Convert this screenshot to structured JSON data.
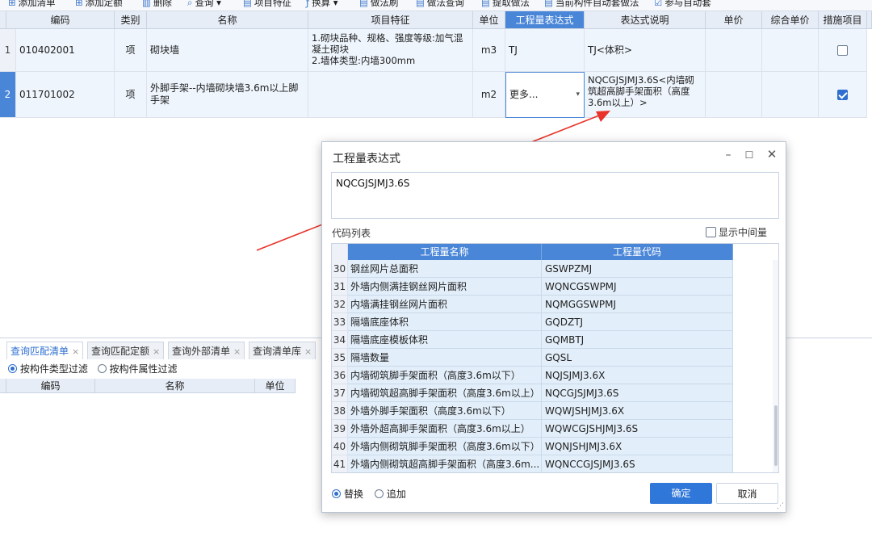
{
  "toolbar": {
    "items": [
      {
        "icon": "add-list-icon",
        "label": "添加清单"
      },
      {
        "icon": "add-quota-icon",
        "label": "添加定额"
      },
      {
        "icon": "delete-icon",
        "label": "删除"
      },
      {
        "icon": "query-icon",
        "label": "查询"
      },
      {
        "icon": "feature-icon",
        "label": "项目特征"
      },
      {
        "icon": "fx-icon",
        "label": "换算"
      },
      {
        "icon": "brush-icon",
        "label": "做法刷"
      },
      {
        "icon": "query-method-icon",
        "label": "做法查询"
      },
      {
        "icon": "extract-icon",
        "label": "提取做法"
      },
      {
        "icon": "auto-icon",
        "label": "当前构件自动套做法"
      },
      {
        "icon": "checkbox-icon",
        "label": "参与自动套"
      }
    ]
  },
  "grid": {
    "headers": [
      "编码",
      "类别",
      "名称",
      "项目特征",
      "单位",
      "工程量表达式",
      "表达式说明",
      "单价",
      "综合单价",
      "措施项目"
    ],
    "rows": [
      {
        "num": "1",
        "code": "010402001",
        "type": "项",
        "name": "砌块墙",
        "feature": "1.砌块品种、规格、强度等级:加气混凝土砌块\n2.墙体类型:内墙300mm",
        "unit": "m3",
        "expr": "TJ",
        "desc": "TJ<体积>",
        "price": "",
        "total_price": "",
        "measure": false
      },
      {
        "num": "2",
        "code": "011701002",
        "type": "项",
        "name": "外脚手架--内墙砌块墙3.6m以上脚手架",
        "feature": "",
        "unit": "m2",
        "expr": "更多...",
        "desc": "NQCGJSJMJ3.6S<内墙砌筑超高脚手架面积（高度3.6m以上）>",
        "price": "",
        "total_price": "",
        "measure": true
      }
    ]
  },
  "bottom": {
    "tabs": [
      "查询匹配清单",
      "查询匹配定额",
      "查询外部清单",
      "查询清单库"
    ],
    "filters": [
      "按构件类型过滤",
      "按构件属性过滤"
    ],
    "headers": [
      "编码",
      "名称",
      "单位"
    ]
  },
  "dialog": {
    "title": "工程量表达式",
    "expression": "NQCGJSJMJ3.6S",
    "codes_label": "代码列表",
    "show_intermediate": "显示中间量",
    "headers": [
      "工程量名称",
      "工程量代码"
    ],
    "rows": [
      {
        "n": "30",
        "name": "钢丝网片总面积",
        "code": "GSWPZMJ"
      },
      {
        "n": "31",
        "name": "外墙内侧满挂钢丝网片面积",
        "code": "WQNCGSWPMJ"
      },
      {
        "n": "32",
        "name": "内墙满挂钢丝网片面积",
        "code": "NQMGGSWPMJ"
      },
      {
        "n": "33",
        "name": "隔墙底座体积",
        "code": "GQDZTJ"
      },
      {
        "n": "34",
        "name": "隔墙底座模板体积",
        "code": "GQMBTJ"
      },
      {
        "n": "35",
        "name": "隔墙数量",
        "code": "GQSL"
      },
      {
        "n": "36",
        "name": "内墙砌筑脚手架面积（高度3.6m以下）",
        "code": "NQJSJMJ3.6X"
      },
      {
        "n": "37",
        "name": "内墙砌筑超高脚手架面积（高度3.6m以上）",
        "code": "NQCGJSJMJ3.6S"
      },
      {
        "n": "38",
        "name": "外墙外脚手架面积（高度3.6m以下）",
        "code": "WQWJSHJMJ3.6X"
      },
      {
        "n": "39",
        "name": "外墙外超高脚手架面积（高度3.6m以上）",
        "code": "WQWCGJSHJMJ3.6S"
      },
      {
        "n": "40",
        "name": "外墙内侧砌筑脚手架面积（高度3.6m以下）",
        "code": "WQNJSHJMJ3.6X"
      },
      {
        "n": "41",
        "name": "外墙内侧砌筑超高脚手架面积（高度3.6m...",
        "code": "WQNCCGJSJMJ3.6S"
      }
    ],
    "mode_replace": "替换",
    "mode_append": "追加",
    "ok": "确定",
    "cancel": "取消"
  },
  "colors": {
    "accent": "#4a86d8",
    "primary_button": "#2f77d8",
    "arrow": "#e8332a"
  }
}
